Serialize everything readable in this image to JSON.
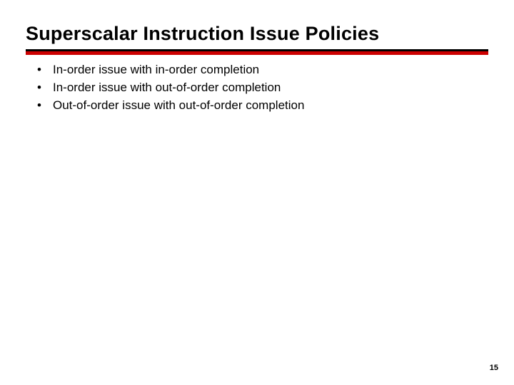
{
  "slide": {
    "title": "Superscalar Instruction Issue Policies",
    "bullets": [
      "In-order issue with in-order completion",
      "In-order issue with out-of-order completion",
      "Out-of-order issue with out-of-order completion"
    ],
    "page_number": "15"
  }
}
